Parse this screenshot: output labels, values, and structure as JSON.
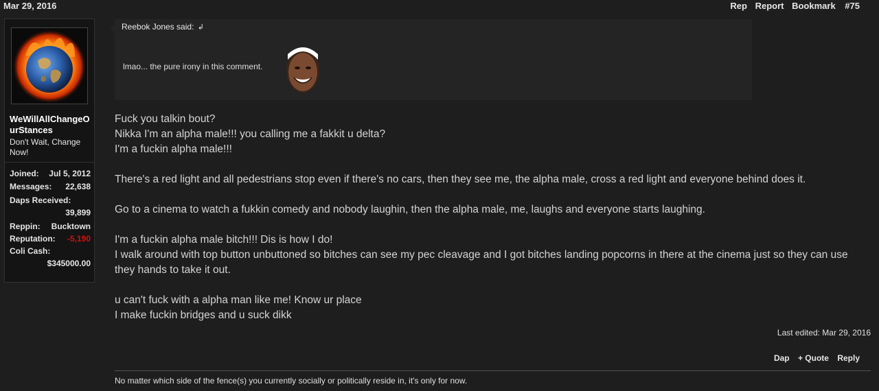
{
  "post": {
    "date": "Mar 29, 2016",
    "actions": {
      "rep": "Rep",
      "report": "Report",
      "bookmark": "Bookmark",
      "number": "#75"
    }
  },
  "user": {
    "name": "WeWillAllChangeOurStances",
    "title": "Don't Wait, Change Now!",
    "stats": {
      "joined_label": "Joined:",
      "joined": "Jul 5, 2012",
      "messages_label": "Messages:",
      "messages": "22,638",
      "daps_label": "Daps Received:",
      "daps": "39,899",
      "reppin_label": "Reppin:",
      "reppin": "Bucktown",
      "reputation_label": "Reputation:",
      "reputation": "-5,190",
      "cash_label": "Coli Cash:",
      "cash": "$345000.00"
    }
  },
  "quote": {
    "author": "Reebok Jones said:",
    "arrow": "↲",
    "text": "lmao... the pure irony in this comment."
  },
  "body": {
    "p1": [
      "Fuck you talkin bout?",
      "Nikka I'm an alpha male!!! you calling me a fakkit u delta?",
      "I'm a fuckin alpha male!!!"
    ],
    "p2": "There's a red light and all pedestrians stop even if there's no cars, then they see me, the alpha male, cross a red light and everyone behind does it.",
    "p3": "Go to a cinema to watch a fukkin comedy and nobody laughin, then the alpha male, me, laughs and everyone starts laughing.",
    "p4": [
      "I'm a fuckin alpha male bitch!!! Dis is how I do!",
      "I walk around with top button unbuttoned so bitches can see my pec cleavage and I got bitches landing popcorns in there at the cinema just so they can use they hands to take it out."
    ],
    "p5": [
      "u can't fuck with a alpha man like me! Know ur place",
      "I make fuckin bridges and u suck dikk"
    ]
  },
  "last_edited": "Last edited: Mar 29, 2016",
  "bottom_actions": {
    "dap": "Dap",
    "quote": "+ Quote",
    "reply": "Reply"
  },
  "signature": {
    "line1": "No matter which side of the fence(s) you currently socially or politically reside in, it's only for now."
  },
  "icons": {
    "avatar": "burning-earth-avatar",
    "quote_emoji": "smiling-face-emoji",
    "quote_link": "return-arrow-icon"
  },
  "colors": {
    "background": "#1e1e1e",
    "quote_bg": "#242424",
    "negative": "#d01010"
  }
}
